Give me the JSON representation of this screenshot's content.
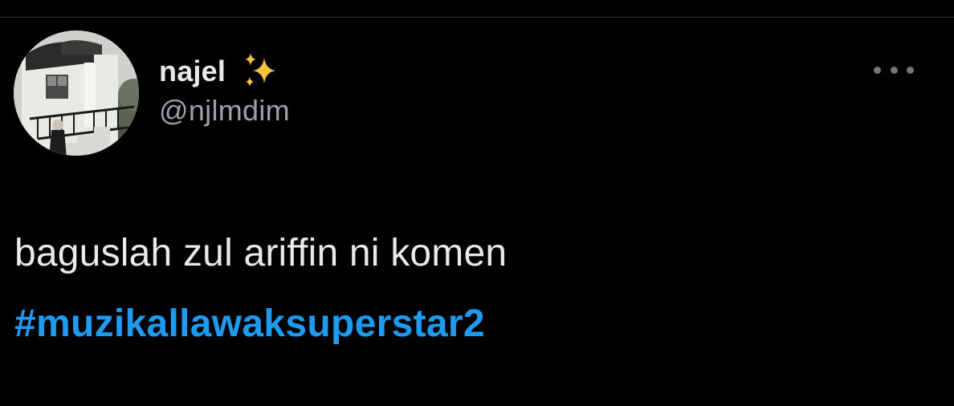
{
  "tweet": {
    "author": {
      "display_name": "najel",
      "emoji": "sparkles",
      "handle": "@njlmdim",
      "avatar": "profile-photo"
    },
    "more_icon": "ellipsis-icon",
    "text_line": "baguslah zul ariffin ni komen",
    "hashtag": "#muzikallawaksuperstar2"
  },
  "colors": {
    "background": "#000000",
    "text": "#e7e9ea",
    "secondary_text": "#9aa1a7",
    "hashtag": "#1d9bf0",
    "divider": "#2f3336",
    "sparkle": "#f5c542"
  }
}
